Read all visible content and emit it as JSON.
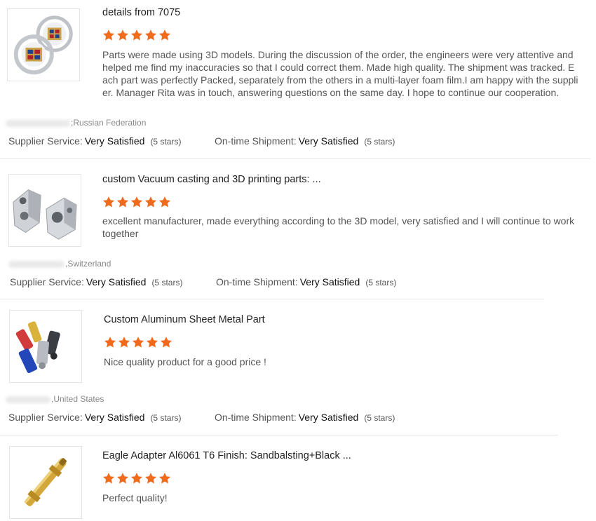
{
  "colors": {
    "star": "#f26b1d",
    "divider": "#e6e6e6"
  },
  "labels": {
    "supplier_service": "Supplier Service:",
    "ontime_shipment": "On-time Shipment:"
  },
  "reviews": [
    {
      "title": "details from 7075",
      "rating": 5,
      "body": "Parts were made using 3D models. During the discussion of the order, the engineers were very attentive and helped me find my inaccuracies so that I could correct them. Made high quality. The shipment was tracked. Each part was perfectly Packed, separately from the others in a multi-layer foam film.I am happy with the supplier. Manager Rita was in touch, answering questions on the same day. I hope to continue our cooperation.",
      "location": ";Russian Federation",
      "supplier_service": "Very Satisfied",
      "supplier_stars": "(5 stars)",
      "ontime_shipment": "Very Satisfied",
      "ontime_stars": "(5 stars)",
      "image": "emblem-badges-image"
    },
    {
      "title": "custom Vacuum casting and 3D printing parts: ...",
      "rating": 5,
      "body": "excellent manufacturer, made everything according to the 3D model, very satisfied and I will continue to work together",
      "location": ",Switzerland",
      "supplier_service": "Very Satisfied",
      "supplier_stars": "(5 stars)",
      "ontime_shipment": "Very Satisfied",
      "ontime_stars": "(5 stars)",
      "image": "aluminum-blocks-image"
    },
    {
      "title": "Custom Aluminum Sheet Metal Part",
      "rating": 5,
      "body": "Nice quality product for a good price !",
      "location": ",United States",
      "supplier_service": "Very Satisfied",
      "supplier_stars": "(5 stars)",
      "ontime_shipment": "Very Satisfied",
      "ontime_stars": "(5 stars)",
      "image": "anodized-fittings-image"
    },
    {
      "title": "Eagle Adapter Al6061 T6 Finish: Sandbalsting+Black ...",
      "rating": 5,
      "body": "Perfect quality!",
      "image": "brass-adapter-image"
    }
  ]
}
